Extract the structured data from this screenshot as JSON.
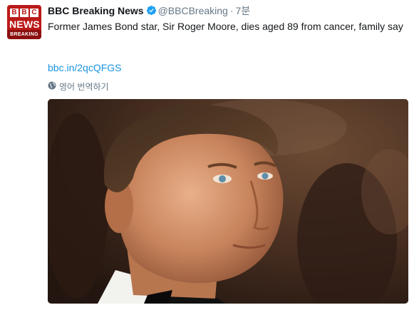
{
  "tweet": {
    "author_name": "BBC Breaking News",
    "author_handle": "@BBCBreaking",
    "separator": "·",
    "timestamp": "7분",
    "text": "Former James Bond star, Sir Roger Moore, dies aged 89 from cancer, family say",
    "link": "bbc.in/2qcQFGS",
    "translate_label": "영어 번역하기",
    "avatar": {
      "letters": [
        "B",
        "B",
        "C"
      ],
      "line1": "NEWS",
      "line2": "BREAKING"
    },
    "media_description_icon": "photo-of-roger-moore"
  },
  "colors": {
    "brand": "#bb1919",
    "link": "#1b95e0",
    "verified": "#1da1f2",
    "muted": "#657786"
  },
  "icons": {
    "verified": "verified-badge-icon",
    "globe": "globe-icon"
  }
}
